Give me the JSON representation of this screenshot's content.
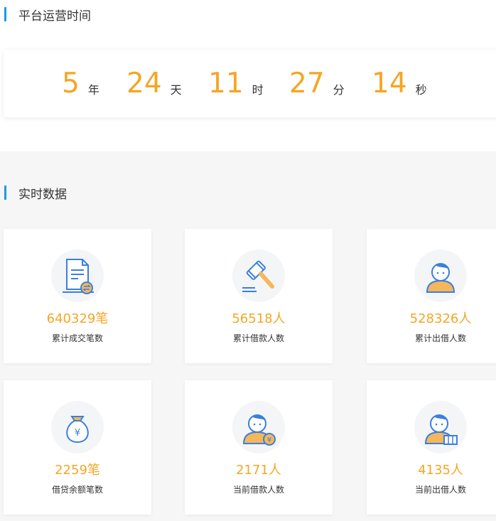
{
  "operation": {
    "title": "平台运营时间",
    "timer": [
      {
        "value": "5",
        "unit": "年"
      },
      {
        "value": "24",
        "unit": "天"
      },
      {
        "value": "11",
        "unit": "时"
      },
      {
        "value": "27",
        "unit": "分"
      },
      {
        "value": "14",
        "unit": "秒"
      }
    ]
  },
  "realtime": {
    "title": "实时数据",
    "stats": [
      {
        "value": "640329笔",
        "label": "累计成交笔数",
        "icon": "document-exchange-icon"
      },
      {
        "value": "56518人",
        "label": "累计借款人数",
        "icon": "gavel-icon"
      },
      {
        "value": "528326人",
        "label": "累计出借人数",
        "icon": "user-icon"
      },
      {
        "value": "2259笔",
        "label": "借贷余额笔数",
        "icon": "money-bag-icon"
      },
      {
        "value": "2171人",
        "label": "当前借款人数",
        "icon": "user-yen-icon"
      },
      {
        "value": "4135人",
        "label": "当前出借人数",
        "icon": "user-cash-icon"
      }
    ]
  },
  "colors": {
    "accent": "#1a9be6",
    "highlight": "#f5a623",
    "icon_blue": "#3a7fe0",
    "icon_orange": "#f5b75a"
  }
}
